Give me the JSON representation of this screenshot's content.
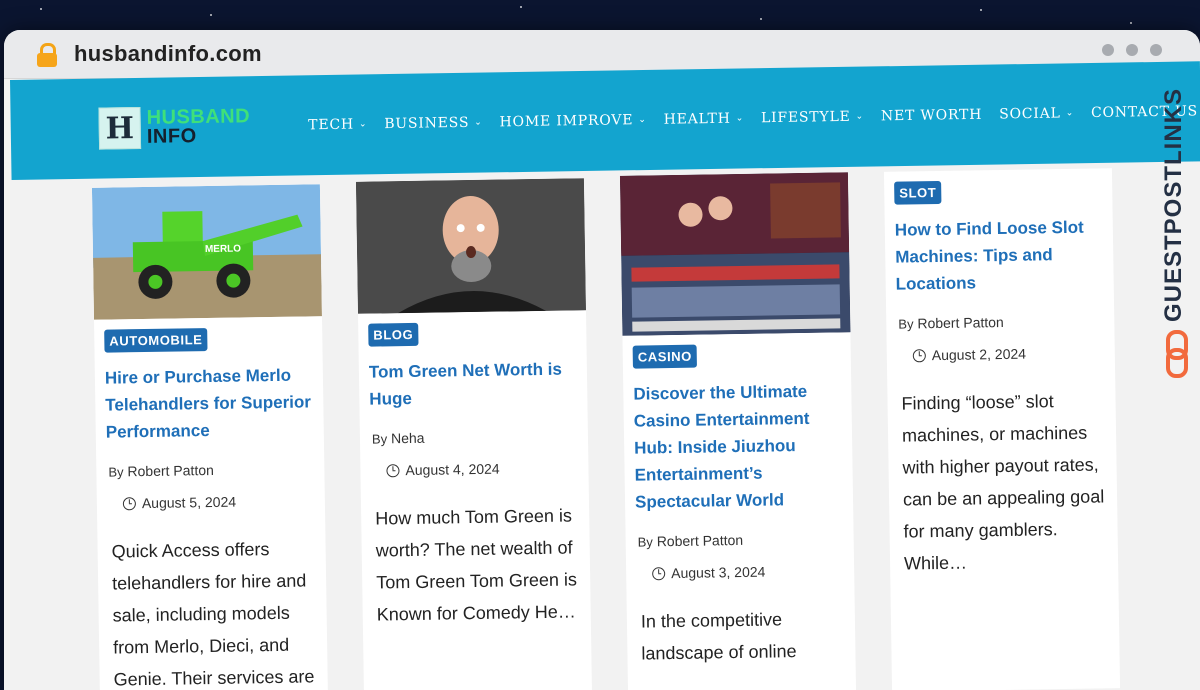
{
  "browser": {
    "url": "husbandinfo.com"
  },
  "logo": {
    "line1": "HUSBAND",
    "line2": "INFO",
    "mark": "H"
  },
  "nav": [
    {
      "label": "TECH",
      "dropdown": true
    },
    {
      "label": "BUSINESS",
      "dropdown": true
    },
    {
      "label": "HOME IMPROVE",
      "dropdown": true
    },
    {
      "label": "HEALTH",
      "dropdown": true
    },
    {
      "label": "LIFESTYLE",
      "dropdown": true
    },
    {
      "label": "NET WORTH",
      "dropdown": false
    },
    {
      "label": "SOCIAL",
      "dropdown": true
    },
    {
      "label": "CONTACT US",
      "dropdown": false
    }
  ],
  "posts": [
    {
      "category": "AUTOMOBILE",
      "title": "Hire or Purchase Merlo Telehandlers for Superior Performance",
      "by_label": "By",
      "author": "Robert Patton",
      "date": "August 5, 2024",
      "excerpt": "Quick Access offers telehandlers for hire and sale, including models from Merlo, Dieci, and Genie. Their services are",
      "image_brand": "MERLO"
    },
    {
      "category": "BLOG",
      "title": "Tom Green Net Worth is Huge",
      "by_label": "By",
      "author": "Neha",
      "date": "August 4, 2024",
      "excerpt": "How much Tom Green is worth? The net wealth of Tom Green Tom Green is Known for Comedy He…"
    },
    {
      "category": "CASINO",
      "title": "Discover the Ultimate Casino Entertainment Hub: Inside Jiuzhou Entertainment’s Spectacular World",
      "by_label": "By",
      "author": "Robert Patton",
      "date": "August 3, 2024",
      "excerpt": "In the competitive landscape of online"
    },
    {
      "category": "SLOT",
      "title": "How to Find Loose Slot Machines: Tips and Locations",
      "by_label": "By",
      "author": "Robert Patton",
      "date": "August 2, 2024",
      "excerpt": "Finding “loose” slot machines, or machines with higher payout rates, can be an appealing goal for many gamblers. While…"
    }
  ],
  "watermark": "GUESTPOSTLINKS",
  "colors": {
    "header": "#13a4cf",
    "badge": "#1e6bb0",
    "title": "#1f6fb8",
    "logo_green": "#3fe07a",
    "chain": "#f26a3d"
  }
}
